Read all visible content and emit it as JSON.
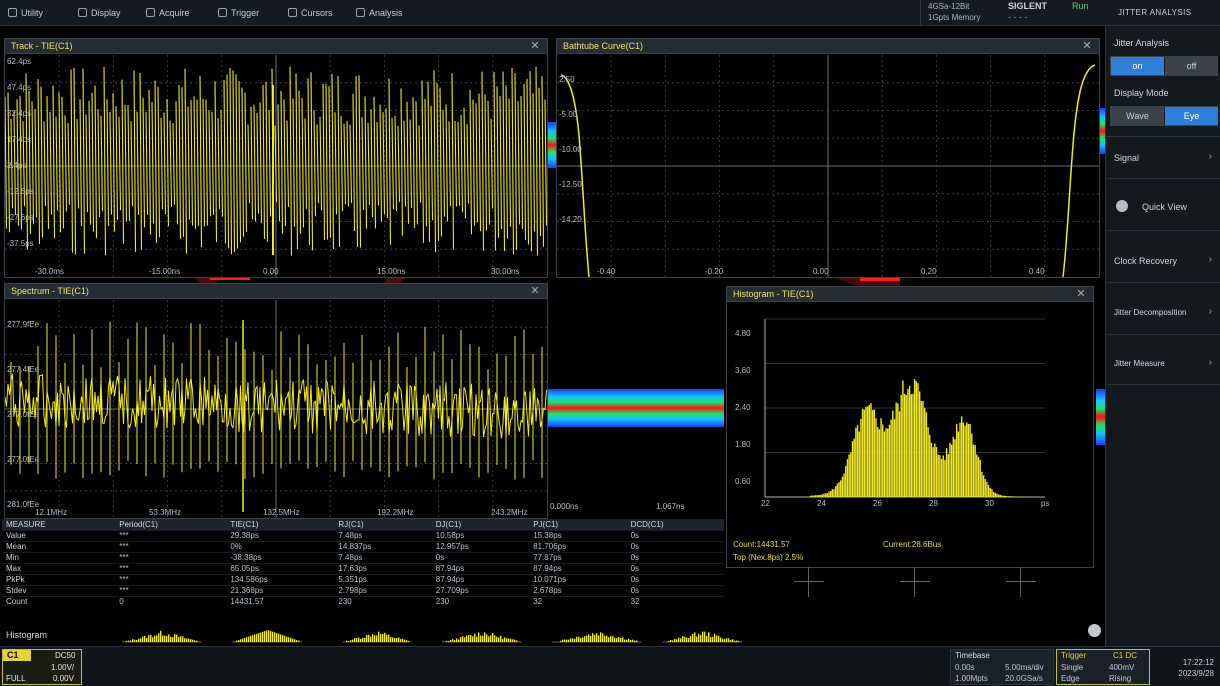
{
  "menu": [
    {
      "label": "Utility",
      "icon": "gear-icon"
    },
    {
      "label": "Display",
      "icon": "display-icon"
    },
    {
      "label": "Acquire",
      "icon": "acquire-icon"
    },
    {
      "label": "Trigger",
      "icon": "trigger-icon"
    },
    {
      "label": "Cursors",
      "icon": "cursor-icon"
    },
    {
      "label": "Analysis",
      "icon": "analysis-icon"
    }
  ],
  "header": {
    "sample_rate": "4GSa-12Bit",
    "memory": "1Gpts Memory",
    "brand": "SIGLENT",
    "brand_sub": "- - - -",
    "run_state": "Run",
    "panel_title": "JITTER ANALYSIS"
  },
  "colors": {
    "trace": "#f2e82a",
    "accent": "#2f7fd8",
    "trigger": "#e2d03c"
  },
  "windows": {
    "track": {
      "title": "Track - TIE(C1)",
      "y_labels": [
        "62.4ps",
        "47.4ps",
        "32.4ps",
        "17.4ps",
        "2.4ps",
        "-12.6ps",
        "-27.6ps",
        "-37.5ps"
      ],
      "x_labels": [
        "-30.0ms",
        "-15.00ns",
        "0.00",
        "15.00ns",
        "30.00ns"
      ]
    },
    "bathtub": {
      "title": "Bathtube Curve(C1)",
      "y_labels": [
        "2.50",
        "-5.00",
        "-10.00",
        "-12.50",
        "-14.20"
      ],
      "x_labels": [
        "-0.40",
        "-0.20",
        "0.00",
        "0.20",
        "0.40"
      ]
    },
    "spectrum": {
      "title": "Spectrum - TIE(C1)",
      "y_labels": [
        "277.9fEe",
        "277.4fEe",
        "277.0fEe",
        "277.0fEe",
        "281.0fEe"
      ],
      "x_labels": [
        "12.1MHz",
        "53.3MHz",
        "132.5MHz",
        "192.2MHz",
        "243.2MHz"
      ]
    },
    "eye": {
      "x_labels": [
        "0.000ns",
        "1.067ns"
      ]
    },
    "histogram": {
      "title": "Histogram - TIE(C1)",
      "y_labels": [
        "4.80",
        "3.60",
        "2.40",
        "1.80",
        "0.60"
      ],
      "x_labels": [
        "22",
        "24",
        "26",
        "28",
        "30",
        "ps"
      ],
      "count": "Count:14431.57",
      "current": "Current:28.6Bus",
      "top": "Top (Nex.8ps) 2.5%"
    }
  },
  "measure": {
    "headers": [
      "MEASURE",
      "Period(C1)",
      "TIE(C1)",
      "RJ(C1)",
      "DJ(C1)",
      "PJ(C1)",
      "DCD(C1)"
    ],
    "rows": [
      [
        "Value",
        "***",
        "29.38ps",
        "7.48ps",
        "10.58ps",
        "15.38ps",
        "0s"
      ],
      [
        "Mean",
        "***",
        "0%",
        "14.837ps",
        "12.957ps",
        "81.706ps",
        "0s"
      ],
      [
        "Min",
        "***",
        "-38.38ps",
        "7.48ps",
        "0s",
        "77.87ps",
        "0s"
      ],
      [
        "Max",
        "***",
        "65.05ps",
        "17.63ps",
        "87.94ps",
        "87.94ps",
        "0s"
      ],
      [
        "PkPk",
        "***",
        "134.586ps",
        "5.351ps",
        "87.94ps",
        "10.071ps",
        "0s"
      ],
      [
        "Stdev",
        "***",
        "21.368ps",
        "2.798ps",
        "27.709ps",
        "2.678ps",
        "0s"
      ],
      [
        "Count",
        "0",
        "14431.57",
        "230",
        "230",
        "32",
        "32"
      ]
    ],
    "histogram_label": "Histogram"
  },
  "panel": {
    "jitter_label": "Jitter Analysis",
    "jitter_on": "on",
    "jitter_off": "off",
    "display_mode_label": "Display Mode",
    "mode_wave": "Wave",
    "mode_eye": "Eye",
    "signal": "Signal",
    "quick_view": "Quick View",
    "clock_recovery": "Clock Recovery",
    "jitter_decomp": "Jitter Decomposition",
    "jitter_measure": "Jitter Measure",
    "chevron": "›"
  },
  "status": {
    "ch1": {
      "tag": "C1",
      "coupling": "DC50",
      "scale": "1.00V/",
      "offset": "FULL",
      "offset_val": "0.00V"
    },
    "timebase": {
      "title": "Timebase",
      "delay": "0.00s",
      "scale": "5.00ms/div",
      "rate": "1.00Mpts",
      "rate2": "20.0GSa/s"
    },
    "trigger": {
      "title": "Trigger",
      "coupling": "C1 DC",
      "mode": "Single",
      "level": "400mV",
      "slope": "Edge",
      "type": "Rising"
    },
    "clock": {
      "time": "17:22:12",
      "date": "2023/9/28"
    }
  }
}
